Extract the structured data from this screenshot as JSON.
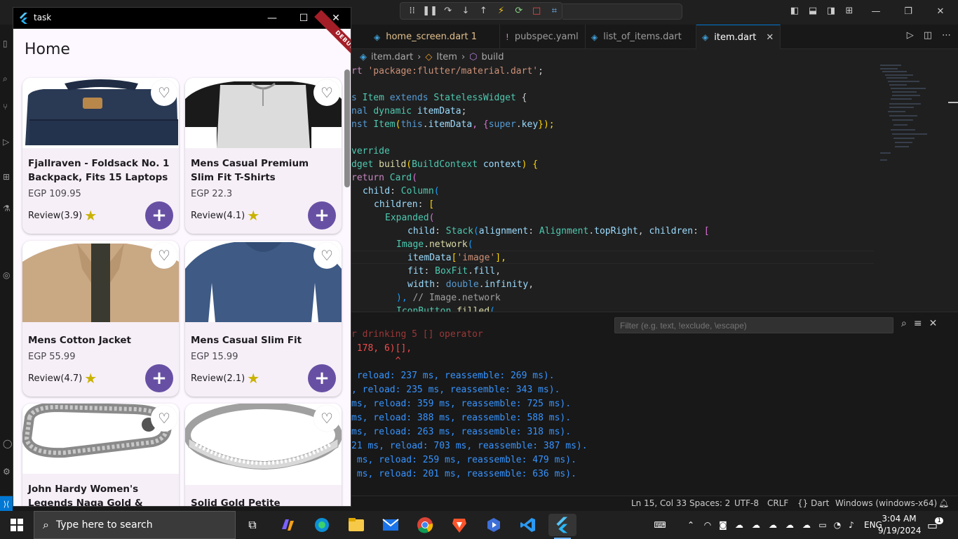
{
  "vscode": {
    "tabs": [
      {
        "label": "home_screen.dart",
        "badge": "1",
        "icon": "dart-icon"
      },
      {
        "label": "pubspec.yaml",
        "icon": "yaml-exclamation-icon"
      },
      {
        "label": "list_of_items.dart",
        "icon": "dart-icon"
      },
      {
        "label": "item.dart",
        "icon": "dart-icon",
        "active": true
      }
    ],
    "breadcrumbs": [
      "item.dart",
      "Item",
      "build"
    ],
    "code": {
      "l1a": "rt ",
      "l1b": "'package:flutter/material.dart'",
      "l1c": ";",
      "l2a": "s ",
      "l2b": "Item",
      "l2c": " extends ",
      "l2d": "StatelessWidget",
      "l2e": " {",
      "l3a": "nal ",
      "l3b": "dynamic",
      "l3c": " itemData",
      "l3d": ";",
      "l4a": "nst ",
      "l4b": "Item",
      "l4c": "(",
      "l4d": "this",
      "l4e": ".",
      "l4f": "itemData",
      "l4g": ", {",
      "l4h": "super",
      "l4i": ".",
      "l4j": "key",
      "l4k": "});",
      "l5a": "verride",
      "l6a": "dget ",
      "l6b": "build",
      "l6c": "(",
      "l6d": "BuildContext",
      "l6e": " context",
      "l6f": ") {",
      "l7a": "return ",
      "l7b": "Card",
      "l7c": "(",
      "l8a": "child",
      "l8b": ": ",
      "l8c": "Column",
      "l8d": "(",
      "l9a": "children",
      "l9b": ": ",
      "l9c": "[",
      "l10a": "Expanded",
      "l10b": "(",
      "l11a": "child",
      "l11b": ": ",
      "l11c": "Stack",
      "l11d": "(",
      "l11e": "alignment",
      "l11f": ": ",
      "l11g": "Alignment",
      "l11h": ".",
      "l11i": "topRight",
      "l11j": ", ",
      "l11k": "children",
      "l11l": ": ",
      "l11m": "[",
      "l12a": "Image",
      "l12b": ".",
      "l12c": "network",
      "l12d": "(",
      "l13a": "itemData",
      "l13b": "[",
      "l13c": "'image'",
      "l13d": "],",
      "l14a": "fit",
      "l14b": ": ",
      "l14c": "BoxFit",
      "l14d": ".",
      "l14e": "fill",
      "l14f": ",",
      "l15a": "width",
      "l15b": ": ",
      "l15c": "double",
      "l15d": ".",
      "l15e": "infinity",
      "l15f": ",",
      "l16a": "), ",
      "l16b": "// Image.network",
      "l17a": "IconButton",
      "l17b": ".",
      "l17c": "filled",
      "l17d": "("
    },
    "output": {
      "filter_placeholder": "Filter (e.g. text, !exclude, \\escape)",
      "lines": [
        "r drinking 5 [] operator",
        " 178, 6)[],",
        "        ^",
        " reload: 237 ms, reassemble: 269 ms).",
        ", reload: 235 ms, reassemble: 343 ms).",
        "ms, reload: 359 ms, reassemble: 725 ms).",
        "ms, reload: 388 ms, reassemble: 588 ms).",
        "ms, reload: 263 ms, reassemble: 318 ms).",
        "21 ms, reload: 703 ms, reassemble: 387 ms).",
        " ms, reload: 259 ms, reassemble: 479 ms).",
        " ms, reload: 201 ms, reassemble: 636 ms)."
      ]
    },
    "status": {
      "position": "Ln 15, Col 33",
      "spaces": "Spaces: 2",
      "encoding": "UTF-8",
      "eol": "CRLF",
      "language": "{} Dart",
      "device": "Windows (windows-x64)"
    }
  },
  "app": {
    "window_title": "task",
    "appbar_title": "Home",
    "debug_banner": "DEBUG",
    "review_prefix": "Review",
    "products": [
      {
        "title": "Fjallraven - Foldsack No. 1 Backpack, Fits 15 Laptops",
        "price": "EGP 109.95",
        "review": "Review(3.9)",
        "image": "backpack"
      },
      {
        "title": "Mens Casual Premium Slim Fit T-Shirts",
        "price": "EGP 22.3",
        "review": "Review(4.1)",
        "image": "tshirt"
      },
      {
        "title": "Mens Cotton Jacket",
        "price": "EGP 55.99",
        "review": "Review(4.7)",
        "image": "jacket"
      },
      {
        "title": "Mens Casual Slim Fit",
        "price": "EGP 15.99",
        "review": "Review(2.1)",
        "image": "longsleeve"
      },
      {
        "title": "John Hardy Women's Legends Naga Gold & Silver Dragon",
        "price": "",
        "review": "",
        "image": "bracelet"
      },
      {
        "title": "Solid Gold Petite Micropave",
        "price": "",
        "review": "",
        "image": "ring"
      }
    ]
  },
  "taskbar": {
    "search_placeholder": "Type here to search",
    "language": "ENG",
    "time": "3:04 AM",
    "date": "9/19/2024",
    "notification_count": "1"
  }
}
